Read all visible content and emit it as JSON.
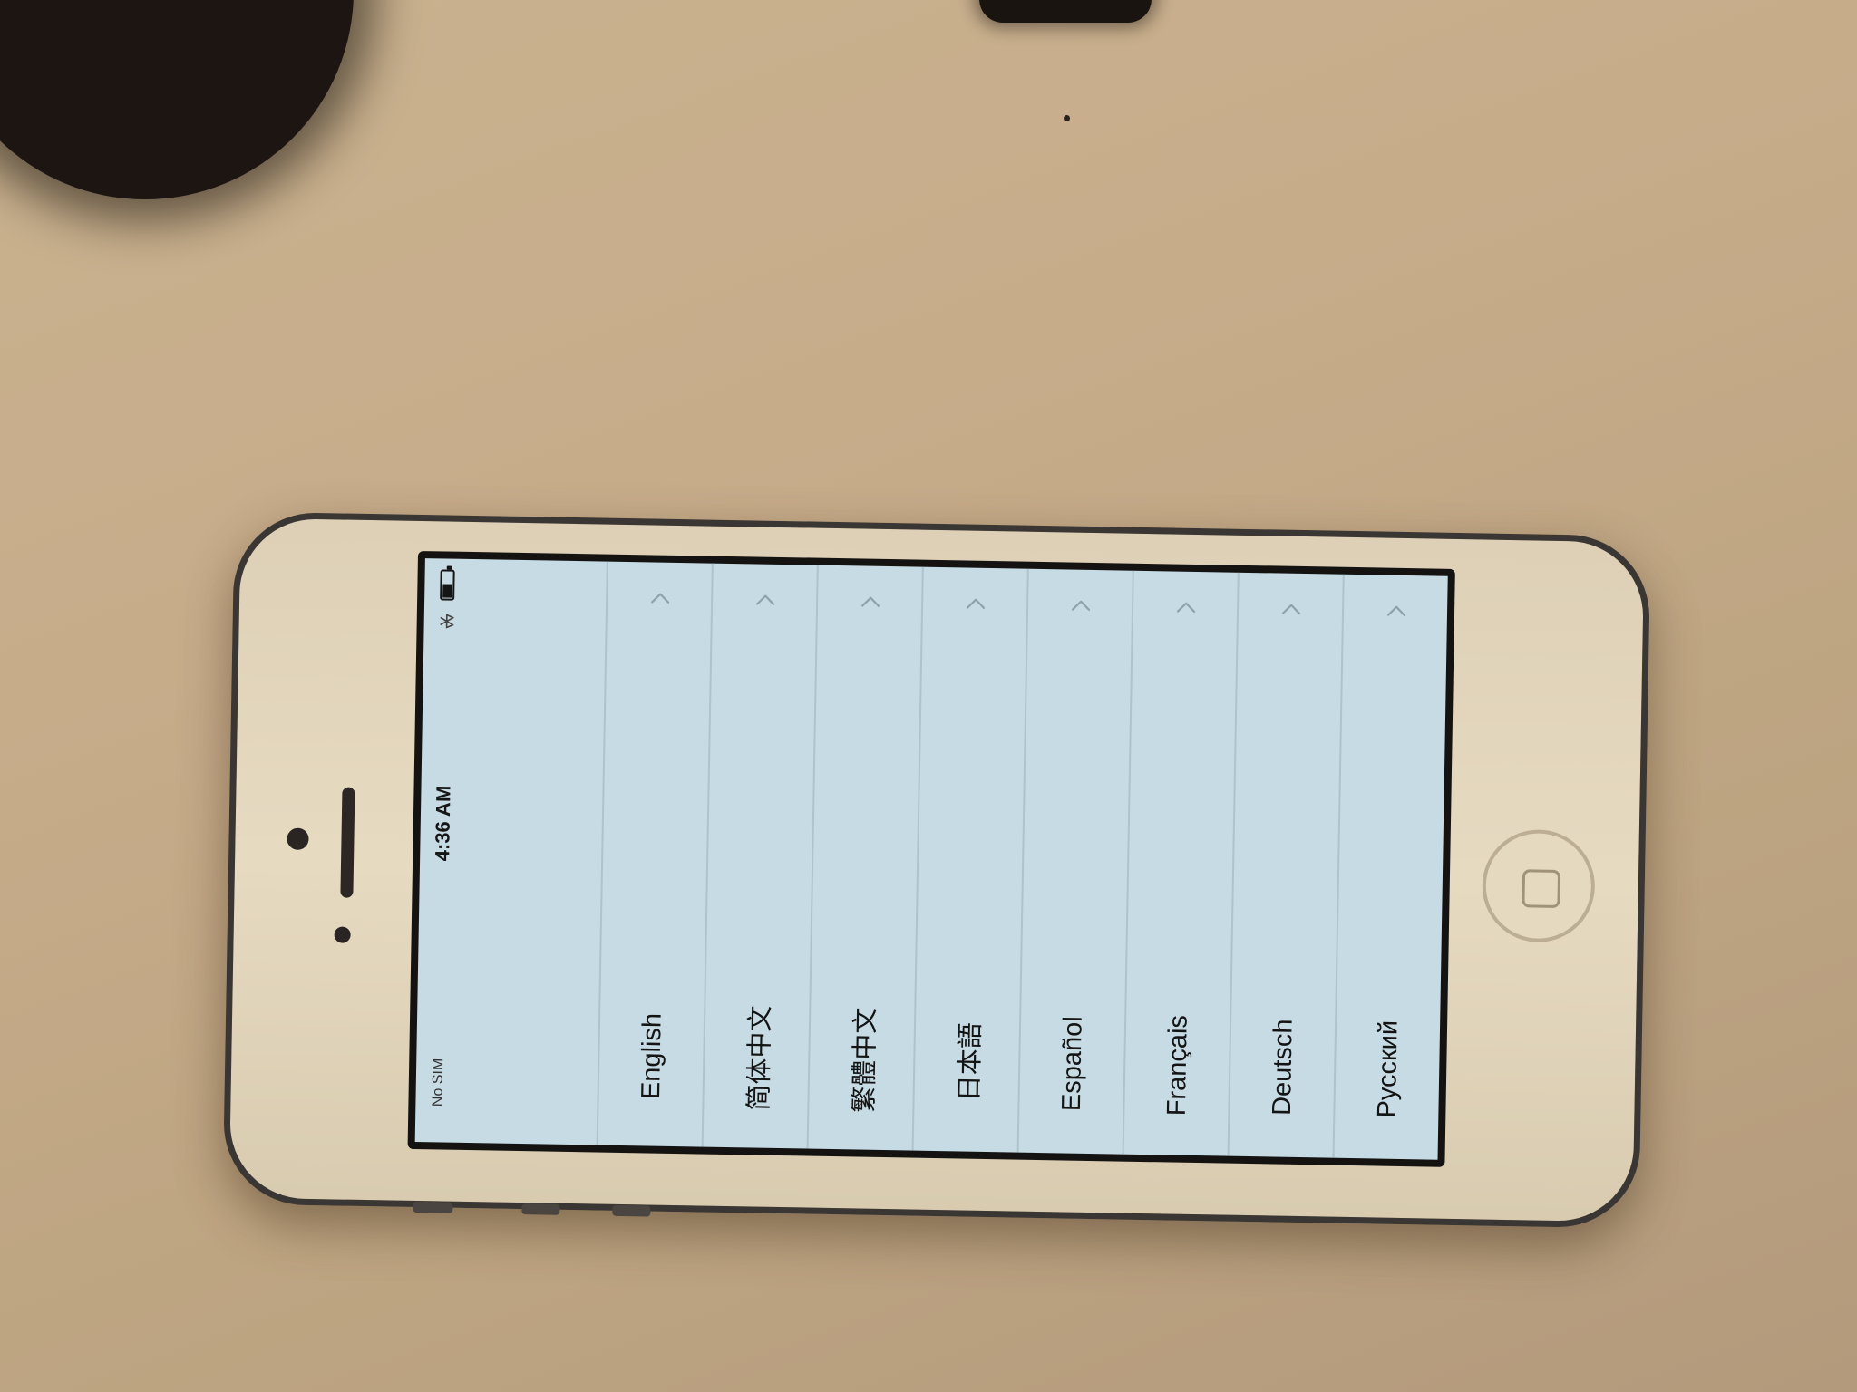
{
  "status_bar": {
    "carrier": "No SIM",
    "time": "4:36 AM",
    "battery_level": 0.55
  },
  "language_list": {
    "items": [
      {
        "label": "English"
      },
      {
        "label": "简体中文"
      },
      {
        "label": "繁體中文"
      },
      {
        "label": "日本語"
      },
      {
        "label": "Español"
      },
      {
        "label": "Français"
      },
      {
        "label": "Deutsch"
      },
      {
        "label": "Русский"
      }
    ],
    "row_icon": "chevron-icon"
  },
  "colors": {
    "screen_background": "#c6dbe4",
    "separator": "#aec3cc",
    "text": "#141414",
    "phone_body": "#e6dac1",
    "phone_frame": "#3a3633"
  }
}
